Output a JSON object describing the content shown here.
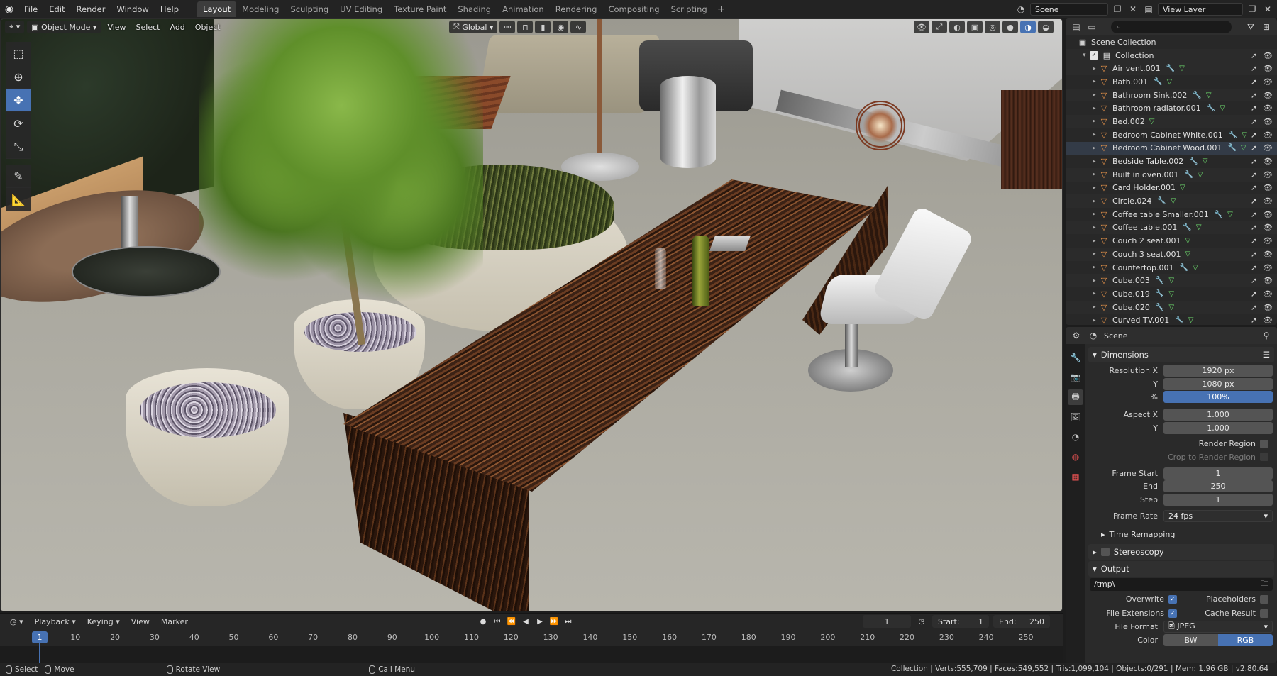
{
  "topbar": {
    "menus": [
      "File",
      "Edit",
      "Render",
      "Window",
      "Help"
    ],
    "workspaces": [
      "Layout",
      "Modeling",
      "Sculpting",
      "UV Editing",
      "Texture Paint",
      "Shading",
      "Animation",
      "Rendering",
      "Compositing",
      "Scripting"
    ],
    "active_workspace": "Layout",
    "scene_name": "Scene",
    "view_layer": "View Layer"
  },
  "viewport": {
    "mode": "Object Mode",
    "menus": [
      "View",
      "Select",
      "Add",
      "Object"
    ],
    "transform_orientation": "Global"
  },
  "timeline": {
    "menus": [
      "Playback",
      "Keying",
      "View",
      "Marker"
    ],
    "current_frame": "1",
    "start_label": "Start:",
    "start": "1",
    "end_label": "End:",
    "end": "250",
    "ruler_ticks": [
      "1",
      "10",
      "20",
      "30",
      "40",
      "50",
      "60",
      "70",
      "80",
      "90",
      "100",
      "110",
      "120",
      "130",
      "140",
      "150",
      "160",
      "170",
      "180",
      "190",
      "200",
      "210",
      "220",
      "230",
      "240",
      "250"
    ]
  },
  "statusbar": {
    "select": "Select",
    "move": "Move",
    "rotate": "Rotate View",
    "call_menu": "Call Menu",
    "stats": "Collection | Verts:555,709 | Faces:549,552 | Tris:1,099,104 | Objects:0/291 | Mem: 1.96 GB | v2.80.64"
  },
  "outliner": {
    "root": "Scene Collection",
    "collection": "Collection",
    "items": [
      {
        "name": "Air vent.001",
        "mod": true
      },
      {
        "name": "Bath.001",
        "mod": true
      },
      {
        "name": "Bathroom Sink.002",
        "mod": true
      },
      {
        "name": "Bathroom radiator.001",
        "mod": true
      },
      {
        "name": "Bed.002",
        "mod": false
      },
      {
        "name": "Bedroom Cabinet White.001",
        "mod": true
      },
      {
        "name": "Bedroom Cabinet Wood.001",
        "mod": true
      },
      {
        "name": "Bedside Table.002",
        "mod": true
      },
      {
        "name": "Built in oven.001",
        "mod": true
      },
      {
        "name": "Card Holder.001",
        "mod": false
      },
      {
        "name": "Circle.024",
        "mod": true
      },
      {
        "name": "Coffee table Smaller.001",
        "mod": true
      },
      {
        "name": "Coffee table.001",
        "mod": true
      },
      {
        "name": "Couch 2 seat.001",
        "mod": false
      },
      {
        "name": "Couch 3 seat.001",
        "mod": false
      },
      {
        "name": "Countertop.001",
        "mod": true
      },
      {
        "name": "Cube.003",
        "mod": true
      },
      {
        "name": "Cube.019",
        "mod": true
      },
      {
        "name": "Cube.020",
        "mod": true
      },
      {
        "name": "Curved TV.001",
        "mod": true
      }
    ]
  },
  "properties": {
    "context": "Scene",
    "dimensions": {
      "title": "Dimensions",
      "res_x_label": "Resolution X",
      "res_x": "1920 px",
      "res_y_label": "Y",
      "res_y": "1080 px",
      "pct_label": "%",
      "pct": "100%",
      "aspect_x_label": "Aspect X",
      "aspect_x": "1.000",
      "aspect_y_label": "Y",
      "aspect_y": "1.000",
      "render_region": "Render Region",
      "crop": "Crop to Render Region",
      "frame_start_label": "Frame Start",
      "frame_start": "1",
      "end_label": "End",
      "end": "250",
      "step_label": "Step",
      "step": "1",
      "frame_rate_label": "Frame Rate",
      "frame_rate": "24 fps",
      "time_remapping": "Time Remapping"
    },
    "stereoscopy": "Stereoscopy",
    "output": {
      "title": "Output",
      "path": "/tmp\\",
      "overwrite": "Overwrite",
      "placeholders": "Placeholders",
      "file_extensions": "File Extensions",
      "cache_result": "Cache Result",
      "file_format_label": "File Format",
      "file_format": "JPEG",
      "color_label": "Color",
      "color_bw": "BW",
      "color_rgb": "RGB"
    }
  }
}
